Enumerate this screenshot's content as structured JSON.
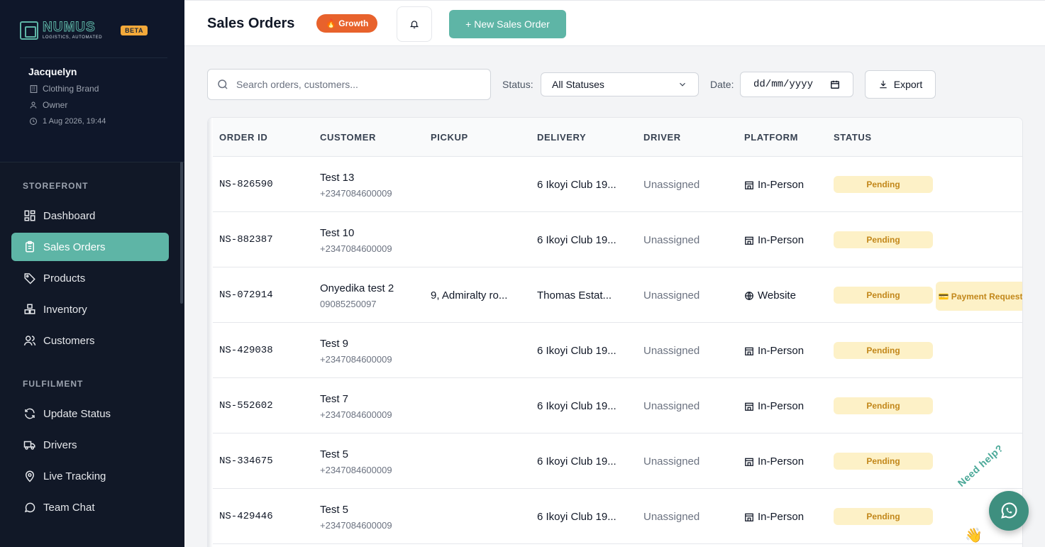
{
  "brand": {
    "name": "NUMUS",
    "tagline": "LOGISTICS, AUTOMATED",
    "badge": "BETA"
  },
  "user": {
    "name": "Jacquelyn",
    "company": "Clothing Brand",
    "role": "Owner",
    "datetime": "1 Aug 2026, 19:44"
  },
  "nav": {
    "storefront_label": "STOREFRONT",
    "fulfilment_label": "FULFILMENT",
    "items": [
      {
        "label": "Dashboard",
        "icon": "dashboard-icon",
        "active": false
      },
      {
        "label": "Sales Orders",
        "icon": "clipboard-icon",
        "active": true
      },
      {
        "label": "Products",
        "icon": "tag-icon",
        "active": false
      },
      {
        "label": "Inventory",
        "icon": "boxes-icon",
        "active": false
      },
      {
        "label": "Customers",
        "icon": "users-icon",
        "active": false
      },
      {
        "label": "Update Status",
        "icon": "refresh-icon",
        "active": false
      },
      {
        "label": "Drivers",
        "icon": "truck-icon",
        "active": false
      },
      {
        "label": "Live Tracking",
        "icon": "map-pin-icon",
        "active": false
      },
      {
        "label": "Team Chat",
        "icon": "chat-icon",
        "active": false
      }
    ]
  },
  "header": {
    "title": "Sales Orders",
    "plan_badge": "🔥 Growth",
    "new_order_label": "+ New Sales Order"
  },
  "filters": {
    "search_placeholder": "Search orders, customers...",
    "status_label": "Status:",
    "status_value": "All Statuses",
    "date_label": "Date:",
    "date_placeholder": "dd/mm/yyyy",
    "export_label": "Export"
  },
  "table": {
    "columns": [
      "ORDER ID",
      "CUSTOMER",
      "PICKUP",
      "DELIVERY",
      "DRIVER",
      "PLATFORM",
      "STATUS"
    ],
    "rows": [
      {
        "id": "NS-826590",
        "customer": "Test 13",
        "phone": "+2347084600009",
        "pickup": "",
        "delivery": "6 Ikoyi Club 19...",
        "driver": "Unassigned",
        "platform": "In-Person",
        "status": "Pending",
        "extra": ""
      },
      {
        "id": "NS-882387",
        "customer": "Test 10",
        "phone": "+2347084600009",
        "pickup": "",
        "delivery": "6 Ikoyi Club 19...",
        "driver": "Unassigned",
        "platform": "In-Person",
        "status": "Pending",
        "extra": ""
      },
      {
        "id": "NS-072914",
        "customer": "Onyedika test 2",
        "phone": "09085250097",
        "pickup": "9, Admiralty ro...",
        "delivery": "Thomas Estat...",
        "driver": "Unassigned",
        "platform": "Website",
        "status": "Pending",
        "extra": "💳 Payment Requested"
      },
      {
        "id": "NS-429038",
        "customer": "Test 9",
        "phone": "+2347084600009",
        "pickup": "",
        "delivery": "6 Ikoyi Club 19...",
        "driver": "Unassigned",
        "platform": "In-Person",
        "status": "Pending",
        "extra": ""
      },
      {
        "id": "NS-552602",
        "customer": "Test 7",
        "phone": "+2347084600009",
        "pickup": "",
        "delivery": "6 Ikoyi Club 19...",
        "driver": "Unassigned",
        "platform": "In-Person",
        "status": "Pending",
        "extra": ""
      },
      {
        "id": "NS-334675",
        "customer": "Test 5",
        "phone": "+2347084600009",
        "pickup": "",
        "delivery": "6 Ikoyi Club 19...",
        "driver": "Unassigned",
        "platform": "In-Person",
        "status": "Pending",
        "extra": ""
      },
      {
        "id": "NS-429446",
        "customer": "Test 5",
        "phone": "+2347084600009",
        "pickup": "",
        "delivery": "6 Ikoyi Club 19...",
        "driver": "Unassigned",
        "platform": "In-Person",
        "status": "Pending",
        "extra": ""
      }
    ]
  },
  "help": {
    "label": "Need help?",
    "wave": "👋"
  },
  "colors": {
    "accent": "#5eb5a6",
    "sidebar": "#0f172a",
    "growth": "#e8622c",
    "pending_bg": "#fdf1c7",
    "pending_text": "#c2871a"
  }
}
